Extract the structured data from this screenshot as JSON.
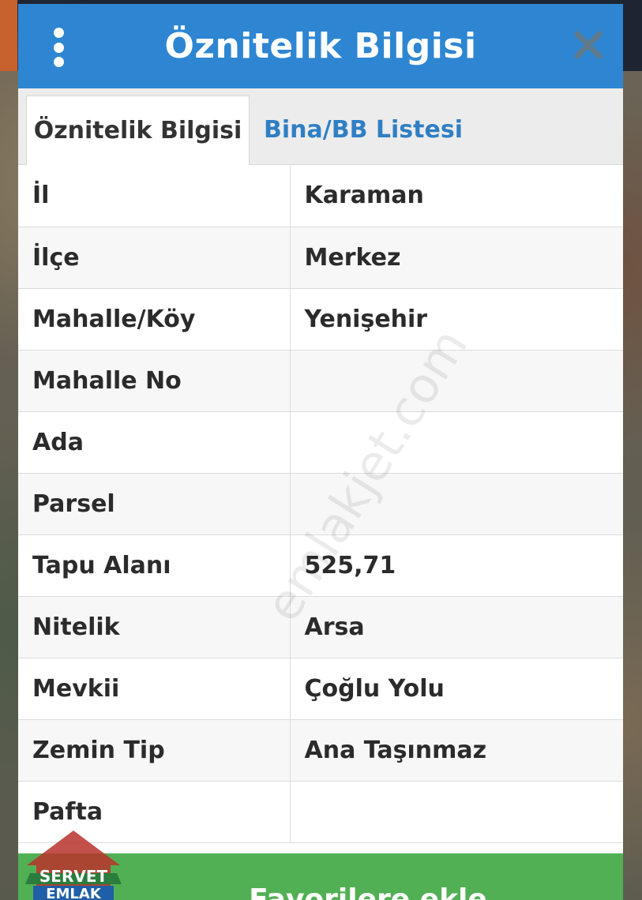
{
  "dialog": {
    "title": "Öznitelik Bilgisi",
    "header_color": "#2e86d2"
  },
  "tabs": [
    {
      "label": "Öznitelik Bilgisi",
      "active": true
    },
    {
      "label": "Bina/BB Listesi",
      "active": false
    }
  ],
  "attributes": [
    {
      "key": "İl",
      "value": "Karaman"
    },
    {
      "key": "İlçe",
      "value": "Merkez"
    },
    {
      "key": "Mahalle/Köy",
      "value": "Yenişehir"
    },
    {
      "key": "Mahalle No",
      "value": ""
    },
    {
      "key": "Ada",
      "value": ""
    },
    {
      "key": "Parsel",
      "value": ""
    },
    {
      "key": "Tapu Alanı",
      "value": "525,71"
    },
    {
      "key": "Nitelik",
      "value": "Arsa"
    },
    {
      "key": "Mevkii",
      "value": "Çoğlu Yolu"
    },
    {
      "key": "Zemin Tip",
      "value": "Ana Taşınmaz"
    },
    {
      "key": "Pafta",
      "value": ""
    }
  ],
  "favorites_button": {
    "label": "Favorilere ekle",
    "color": "#52b054"
  },
  "watermark": "emlakjet.com",
  "logo": {
    "line1": "SERVET",
    "line2": "EMLAK"
  }
}
